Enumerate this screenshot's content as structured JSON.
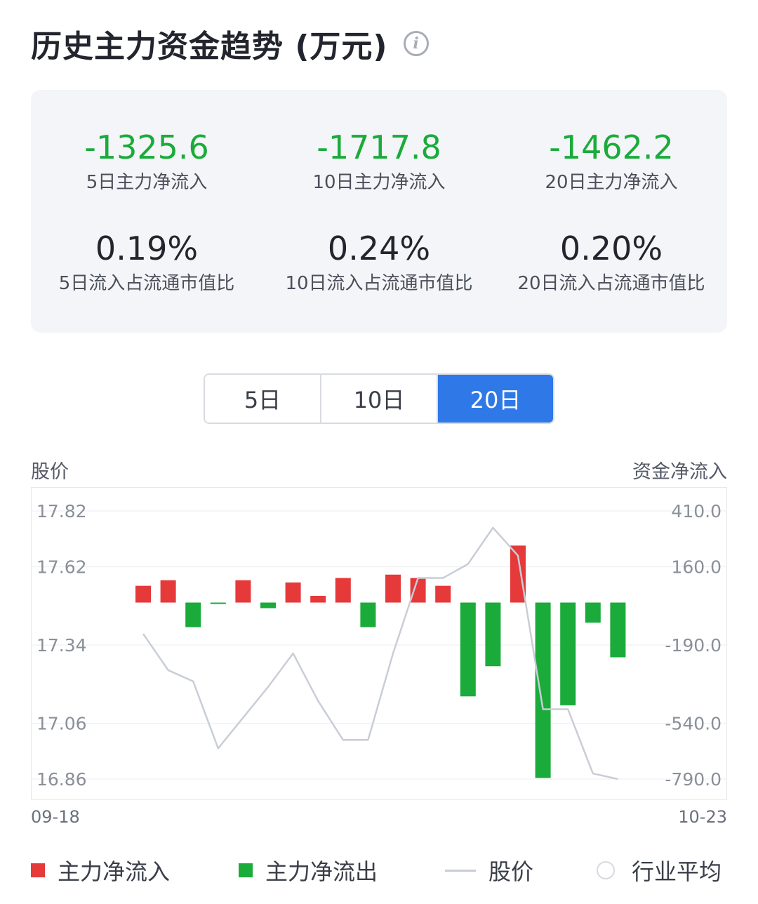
{
  "header": {
    "title": "历史主力资金趋势 (万元)"
  },
  "stats": [
    {
      "value": "-1325.6",
      "label": "5日主力净流入",
      "tone": "neg"
    },
    {
      "value": "-1717.8",
      "label": "10日主力净流入",
      "tone": "neg"
    },
    {
      "value": "-1462.2",
      "label": "20日主力净流入",
      "tone": "neg"
    },
    {
      "value": "0.19%",
      "label": "5日流入占流通市值比",
      "tone": "neutral"
    },
    {
      "value": "0.24%",
      "label": "10日流入占流通市值比",
      "tone": "neutral"
    },
    {
      "value": "0.20%",
      "label": "20日流入占流通市值比",
      "tone": "neutral"
    }
  ],
  "period_tabs": {
    "items": [
      "5日",
      "10日",
      "20日"
    ],
    "active": "20日"
  },
  "chart_data": {
    "type": "bar",
    "left_axis_title": "股价",
    "right_axis_title": "资金净流入",
    "left_ticks": [
      17.82,
      17.62,
      17.34,
      17.06,
      16.86
    ],
    "right_ticks": [
      410.0,
      160.0,
      -190.0,
      -540.0,
      -790.0
    ],
    "left_ylim": [
      16.86,
      17.82
    ],
    "right_ylim": [
      -790.0,
      410.0
    ],
    "x_start_label": "09-18",
    "x_end_label": "10-23",
    "bar_count": 20,
    "series": [
      {
        "name": "主力净流入 / 主力净流出",
        "axis": "right",
        "values": [
          75,
          100,
          -110,
          -5,
          100,
          -25,
          90,
          30,
          110,
          -110,
          125,
          110,
          75,
          -420,
          -285,
          255,
          -785,
          -460,
          -90,
          -245
        ]
      },
      {
        "name": "股价",
        "axis": "left",
        "values": [
          17.38,
          17.25,
          17.21,
          16.97,
          17.08,
          17.19,
          17.31,
          17.14,
          17.0,
          17.0,
          17.31,
          17.58,
          17.58,
          17.63,
          17.76,
          17.66,
          17.11,
          17.11,
          16.88,
          16.86
        ]
      }
    ],
    "grid": true,
    "colors": {
      "inflow": "#e5393a",
      "outflow": "#1aab3a",
      "price_line": "#c9cdd6"
    },
    "legend": [
      {
        "label": "主力净流入",
        "swatch": "square",
        "color": "#e5393a"
      },
      {
        "label": "主力净流出",
        "swatch": "square",
        "color": "#1aab3a"
      },
      {
        "label": "股价",
        "swatch": "line",
        "color": "#c9cdd6"
      },
      {
        "label": "行业平均",
        "swatch": "circle",
        "color": "#d6d9df"
      }
    ]
  }
}
